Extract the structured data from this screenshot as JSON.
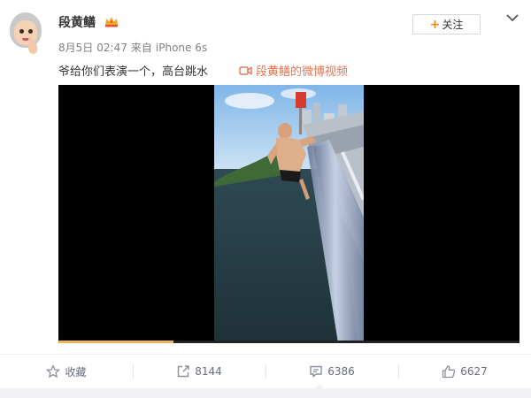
{
  "post": {
    "username": "段黄鳝",
    "date": "8月5日",
    "time": "02:47",
    "source_prefix": "来自",
    "device": "iPhone 6s",
    "text": "爷给你们表演一个，高台跳水",
    "video_link": "段黄鳝的微博视频",
    "follow_label": "关注"
  },
  "video": {
    "progress_fraction": 0.25
  },
  "actions": [
    {
      "icon": "star-icon",
      "label": "收藏"
    },
    {
      "icon": "repost-icon",
      "label": "8144"
    },
    {
      "icon": "comment-icon",
      "label": "6386"
    },
    {
      "icon": "thumbs-up-icon",
      "label": "6627"
    }
  ],
  "colors": {
    "accent_orange": "#ff8200",
    "link": "#eb7350",
    "muted": "#808080"
  }
}
